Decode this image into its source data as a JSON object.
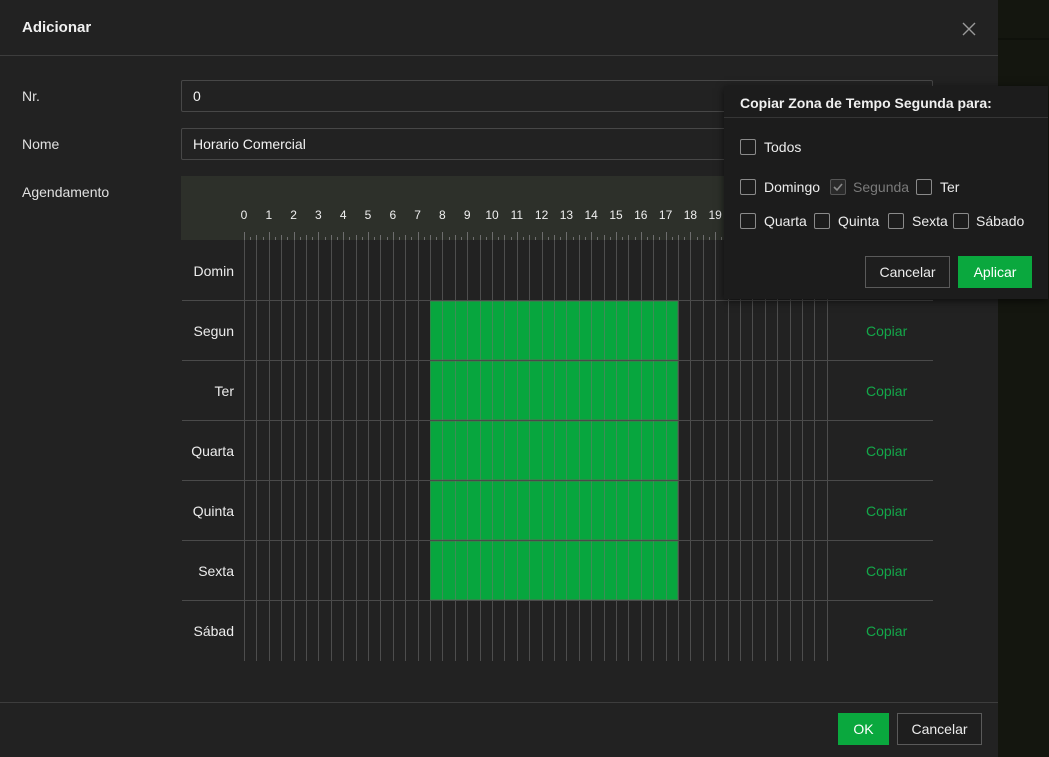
{
  "dialog": {
    "title": "Adicionar",
    "close_icon": "close-icon"
  },
  "form": {
    "nr_label": "Nr.",
    "nr_value": "0",
    "nome_label": "Nome",
    "nome_value": "Horario Comercial",
    "agendamento_label": "Agendamento"
  },
  "schedule": {
    "hours_visible": [
      "0",
      "1",
      "2",
      "3",
      "4",
      "5",
      "6",
      "7",
      "8",
      "9",
      "10",
      "11",
      "12",
      "13",
      "14",
      "15",
      "16",
      "17",
      "18",
      "19"
    ],
    "days": [
      {
        "label": "Domin",
        "copy": ""
      },
      {
        "label": "Segun",
        "copy": "Copiar"
      },
      {
        "label": "Ter",
        "copy": "Copiar"
      },
      {
        "label": "Quarta",
        "copy": "Copiar"
      },
      {
        "label": "Quinta",
        "copy": "Copiar"
      },
      {
        "label": "Sexta",
        "copy": "Copiar"
      },
      {
        "label": "Sábad",
        "copy": "Copiar"
      }
    ],
    "active_period": {
      "start_hour": 7.5,
      "end_hour": 17.5,
      "days": [
        "Segun",
        "Ter",
        "Quarta",
        "Quinta",
        "Sexta"
      ]
    },
    "active_color": "#07a63e",
    "link_color": "#14a84a"
  },
  "footer": {
    "ok_label": "OK",
    "cancel_label": "Cancelar"
  },
  "copy_popup": {
    "title": "Copiar Zona de Tempo Segunda para:",
    "todos": {
      "label": "Todos",
      "checked": false
    },
    "options": [
      {
        "label": "Domingo",
        "checked": false,
        "disabled": false
      },
      {
        "label": "Segunda",
        "checked": true,
        "disabled": true
      },
      {
        "label": "Ter",
        "checked": false,
        "disabled": false
      },
      {
        "label": "Quarta",
        "checked": false,
        "disabled": false
      },
      {
        "label": "Quinta",
        "checked": false,
        "disabled": false
      },
      {
        "label": "Sexta",
        "checked": false,
        "disabled": false
      },
      {
        "label": "Sábado",
        "checked": false,
        "disabled": false
      }
    ],
    "cancel_label": "Cancelar",
    "apply_label": "Aplicar"
  },
  "colors": {
    "primary": "#0aa83e",
    "background": "#222222"
  }
}
